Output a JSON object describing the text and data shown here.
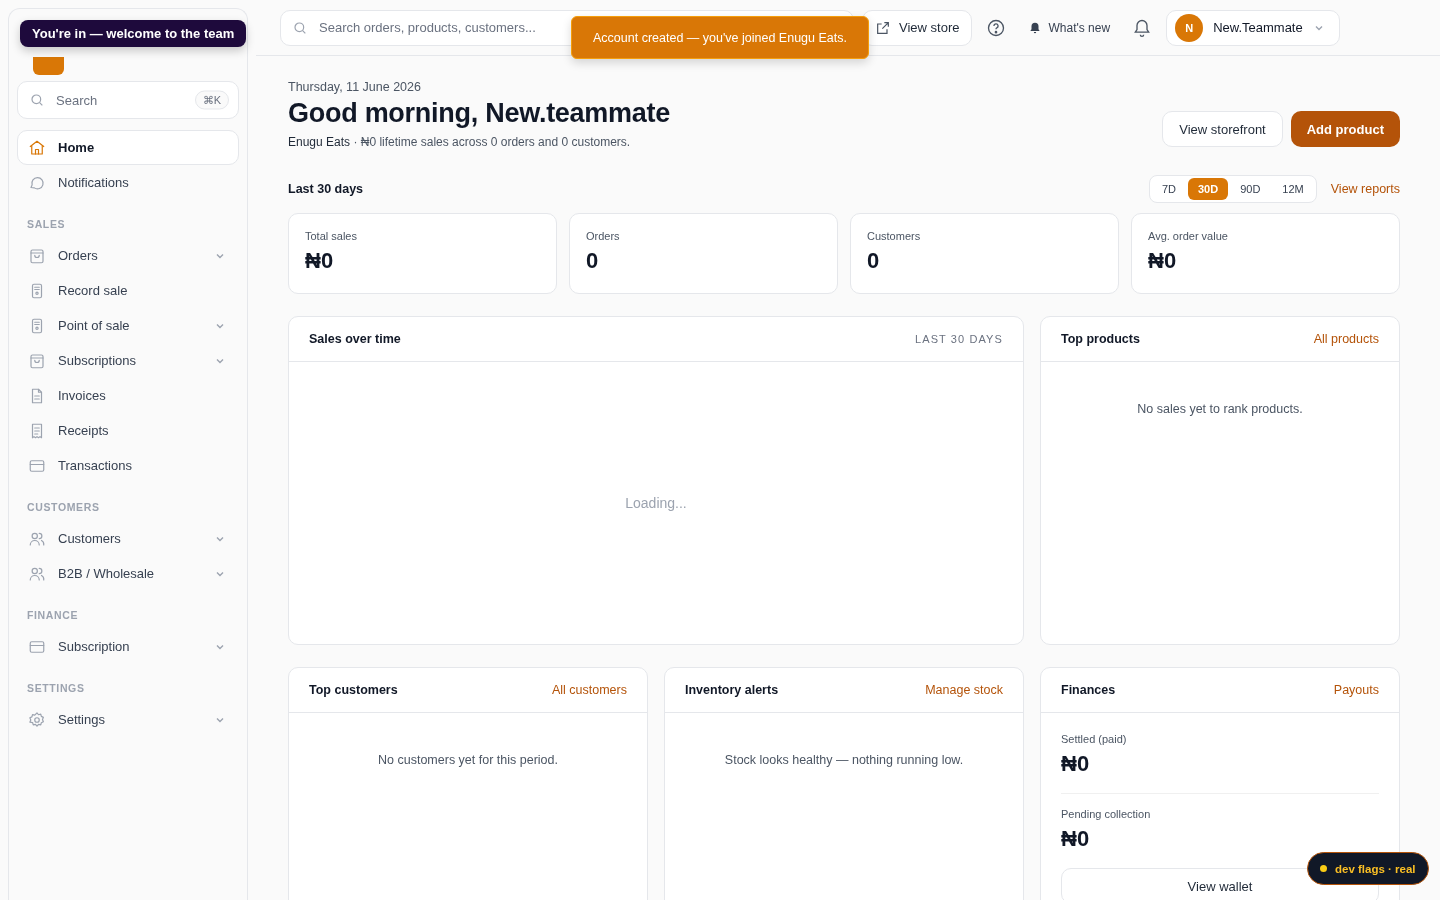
{
  "toasts": {
    "welcome": "You're in — welcome to the team",
    "account": "Account created — you've joined Enugu Eats."
  },
  "sidebar": {
    "search": {
      "placeholder": "Search",
      "shortcut": "⌘K"
    },
    "top_items": [
      {
        "label": "Home",
        "kind": "home",
        "selected": true
      },
      {
        "label": "Notifications",
        "kind": "chat",
        "selected": false
      }
    ],
    "groups": [
      {
        "title": "SALES",
        "items": [
          {
            "label": "Orders",
            "kind": "bag",
            "expandable": true
          },
          {
            "label": "Record sale",
            "kind": "pos",
            "expandable": false
          },
          {
            "label": "Point of sale",
            "kind": "pos",
            "expandable": true
          },
          {
            "label": "Subscriptions",
            "kind": "bag",
            "expandable": true
          },
          {
            "label": "Invoices",
            "kind": "doc",
            "expandable": false
          },
          {
            "label": "Receipts",
            "kind": "receipt",
            "expandable": false
          },
          {
            "label": "Transactions",
            "kind": "card",
            "expandable": false
          }
        ]
      },
      {
        "title": "CUSTOMERS",
        "items": [
          {
            "label": "Customers",
            "kind": "users",
            "expandable": true
          },
          {
            "label": "B2B / Wholesale",
            "kind": "users",
            "expandable": true
          }
        ]
      },
      {
        "title": "FINANCE",
        "items": [
          {
            "label": "Subscription",
            "kind": "card",
            "expandable": true
          }
        ]
      },
      {
        "title": "SETTINGS",
        "items": [
          {
            "label": "Settings",
            "kind": "gear",
            "expandable": true
          }
        ]
      }
    ]
  },
  "topbar": {
    "search_placeholder": "Search orders, products, customers...",
    "view_store": "View store",
    "whats_new": "What's new",
    "user": {
      "initial": "N",
      "name": "New.Teammate"
    }
  },
  "header": {
    "date": "Thursday, 11 June 2026",
    "greeting": "Good morning, New.teammate",
    "store": "Enugu Eats",
    "summary": " · ₦0 lifetime sales across 0 orders and 0 customers.",
    "buttons": [
      "View storefront",
      "Add product"
    ]
  },
  "period": {
    "title": "Last 30 days",
    "ranges": [
      {
        "label": "7D",
        "selected": false
      },
      {
        "label": "30D",
        "selected": true
      },
      {
        "label": "90D",
        "selected": false
      },
      {
        "label": "12M",
        "selected": false
      }
    ],
    "link": "View reports"
  },
  "stats": [
    {
      "label": "Total sales",
      "value": "₦0"
    },
    {
      "label": "Orders",
      "value": "0"
    },
    {
      "label": "Customers",
      "value": "0"
    },
    {
      "label": "Avg. order value",
      "value": "₦0"
    }
  ],
  "sales_over_time": {
    "title": "Sales over time",
    "range": "LAST 30 DAYS",
    "status": "Loading..."
  },
  "top_products": {
    "title": "Top products",
    "link": "All products",
    "empty": "No sales yet to rank products."
  },
  "top_customers": {
    "title": "Top customers",
    "link": "All customers",
    "empty": "No customers yet for this period."
  },
  "inventory_alerts": {
    "title": "Inventory alerts",
    "link": "Manage stock",
    "empty": "Stock looks healthy — nothing running low."
  },
  "finances": {
    "title": "Finances",
    "link": "Payouts",
    "rows": [
      {
        "label": "Settled (paid)",
        "value": "₦0"
      },
      {
        "label": "Pending collection",
        "value": "₦0"
      }
    ],
    "button": "View wallet"
  },
  "dev_flags": {
    "label": "dev flags · real",
    "color": "#facc15"
  }
}
